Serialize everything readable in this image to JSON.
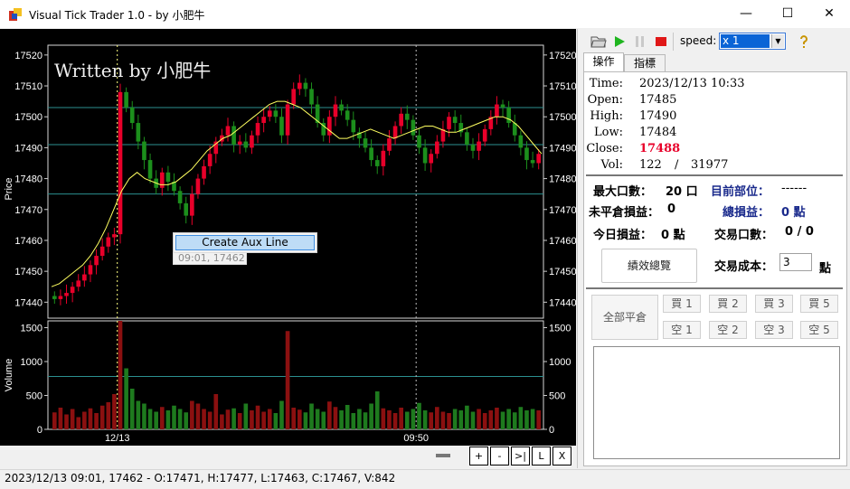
{
  "window": {
    "title": "Visual Tick Trader 1.0 - by 小肥牛",
    "minimize": "—",
    "maximize": "☐",
    "close": "✕"
  },
  "toolbar": {
    "speed_label": "speed:",
    "speed_value": "x 1",
    "icons": [
      "open-folder-icon",
      "play-icon",
      "pause-icon",
      "stop-icon",
      "help-icon"
    ]
  },
  "tabs": [
    "操作",
    "指標"
  ],
  "quote": {
    "time_label": "Time:",
    "time": "2023/12/13 10:33",
    "open_label": "Open:",
    "open": "17485",
    "high_label": "High:",
    "high": "17490",
    "low_label": "Low:",
    "low": "17484",
    "close_label": "Close:",
    "close": "17488",
    "vol_label": "Vol:",
    "vol": "122",
    "vol_sep": "/",
    "vol_total": "31977"
  },
  "account": {
    "max_lots_label": "最大口數：",
    "max_lots": "20 口",
    "position_label": "目前部位：",
    "position": "------",
    "unrealized_label": "未平倉損益：",
    "unrealized": "0",
    "total_pl_label": "總損益：",
    "total_pl": "0 點",
    "today_pl_label": "今日損益：",
    "today_pl": "0 點",
    "trades_label": "交易口數：",
    "trades": "0 / 0",
    "perf_button": "績效總覽",
    "cost_label": "交易成本：",
    "cost_value": "3",
    "cost_unit": "點"
  },
  "trade_buttons": {
    "close_all": "全部平倉",
    "buy": [
      "買 1",
      "買 2",
      "買 3",
      "買 5"
    ],
    "sell": [
      "空 1",
      "空 2",
      "空 3",
      "空 5"
    ]
  },
  "chart_nav": [
    "+",
    "-",
    ">|",
    "L",
    "X"
  ],
  "context_menu": {
    "item": "Create Aux Line",
    "tooltip": "09:01, 17462"
  },
  "status_bar": "2023/12/13 09:01, 17462 - O:17471, H:17477, L:17463, C:17467, V:842",
  "colors": {
    "up": "#e8002a",
    "down": "#1c8f1c",
    "ma": "#ffff60",
    "aux_line": "#2b8f8f",
    "vol_up": "#8b1010",
    "vol_down": "#1e7a1e",
    "close_value": "#e8002a"
  },
  "chart_data": [
    {
      "type": "candlestick",
      "title": "",
      "watermark": "Written by 小肥牛",
      "ylabel": "Price",
      "ylim": [
        17436,
        17522
      ],
      "yticks": [
        17440,
        17450,
        17460,
        17470,
        17480,
        17490,
        17500,
        17510,
        17520
      ],
      "grid": false,
      "aux_lines": [
        17503,
        17491,
        17475
      ],
      "x_labels": [
        "12/13",
        "09:50"
      ],
      "series": [
        {
          "name": "",
          "ohlc_summary": "intraday candles from 09:01 to 10:33; low ~17439, high ~17517"
        }
      ],
      "close": [
        17441,
        17442,
        17443,
        17445,
        17447,
        17449,
        17452,
        17455,
        17458,
        17461,
        17462,
        17508,
        17503,
        17498,
        17492,
        17486,
        17480,
        17477,
        17482,
        17479,
        17476,
        17472,
        17468,
        17475,
        17480,
        17484,
        17488,
        17492,
        17494,
        17497,
        17491,
        17492,
        17490,
        17494,
        17498,
        17500,
        17502,
        17500,
        17494,
        17504,
        17509,
        17511,
        17509,
        17504,
        17498,
        17494,
        17500,
        17504,
        17502,
        17499,
        17495,
        17493,
        17490,
        17486,
        17484,
        17489,
        17493,
        17497,
        17501,
        17499,
        17494,
        17490,
        17485,
        17488,
        17492,
        17496,
        17500,
        17498,
        17495,
        17491,
        17489,
        17492,
        17496,
        17500,
        17504,
        17503,
        17498,
        17494,
        17490,
        17486,
        17485,
        17488
      ],
      "ma": [
        17445,
        17446,
        17448,
        17450,
        17452,
        17455,
        17459,
        17464,
        17470,
        17476,
        17480,
        17482,
        17480,
        17479,
        17478,
        17478,
        17479,
        17481,
        17483,
        17486,
        17489,
        17491,
        17493,
        17494,
        17496,
        17498,
        17500,
        17502,
        17504,
        17505,
        17505,
        17504,
        17503,
        17501,
        17499,
        17497,
        17495,
        17493,
        17493,
        17494,
        17495,
        17496,
        17495,
        17494,
        17493,
        17494,
        17495,
        17496,
        17497,
        17497,
        17496,
        17495,
        17495,
        17496,
        17497,
        17498,
        17499,
        17500,
        17500,
        17499,
        17497,
        17494,
        17491,
        17488
      ]
    },
    {
      "type": "bar",
      "title": "",
      "ylabel": "Volume",
      "ylim": [
        0,
        1600
      ],
      "yticks": [
        0,
        500,
        1000,
        1500
      ],
      "aux_lines": [
        780
      ],
      "values": [
        250,
        320,
        220,
        300,
        180,
        260,
        310,
        240,
        350,
        400,
        520,
        1620,
        900,
        600,
        420,
        380,
        300,
        260,
        330,
        280,
        350,
        300,
        250,
        420,
        380,
        300,
        260,
        520,
        220,
        290,
        310,
        240,
        380,
        280,
        350,
        260,
        300,
        240,
        420,
        1450,
        320,
        290,
        250,
        380,
        300,
        260,
        410,
        330,
        280,
        360,
        240,
        300,
        250,
        380,
        560,
        310,
        280,
        240,
        320,
        260,
        300,
        390,
        280,
        250,
        330,
        260,
        240,
        300,
        280,
        350,
        260,
        300,
        240,
        280,
        320,
        260,
        300,
        250,
        330,
        280,
        300,
        280
      ]
    }
  ]
}
